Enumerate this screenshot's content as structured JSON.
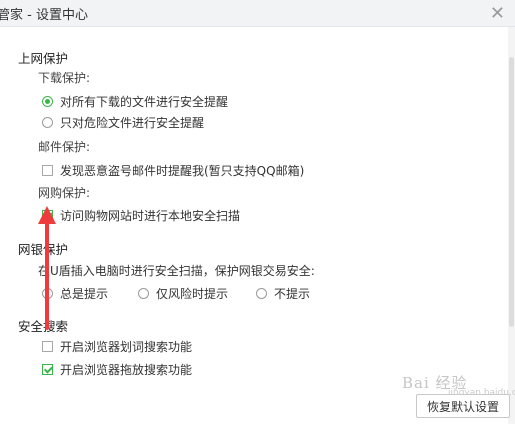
{
  "window": {
    "title": "管家 - 设置中心"
  },
  "sections": [
    {
      "title": "上网保护",
      "groups": [
        {
          "label": "下载保护:",
          "options": [
            {
              "type": "radio",
              "label": "对所有下载的文件进行安全提醒",
              "checked": true
            },
            {
              "type": "radio",
              "label": "只对危险文件进行安全提醒",
              "checked": false
            }
          ]
        },
        {
          "label": "邮件保护:",
          "options": [
            {
              "type": "checkbox",
              "label": "发现恶意盗号邮件时提醒我(暂只支持QQ邮箱)",
              "checked": false
            }
          ]
        },
        {
          "label": "网购保护:",
          "options": [
            {
              "type": "checkbox",
              "label": "访问购物网站时进行本地安全扫描",
              "checked": true
            }
          ]
        }
      ]
    },
    {
      "title": "网银保护",
      "description": "在U盾插入电脑时进行安全扫描，保护网银交易安全:",
      "options": [
        {
          "type": "radio",
          "label": "总是提示",
          "checked": false
        },
        {
          "type": "radio",
          "label": "仅风险时提示",
          "checked": false
        },
        {
          "type": "radio",
          "label": "不提示",
          "checked": false
        }
      ]
    },
    {
      "title": "安全搜索",
      "options": [
        {
          "type": "checkbox",
          "label": "开启浏览器划词搜索功能",
          "checked": false
        },
        {
          "type": "checkbox",
          "label": "开启浏览器拖放搜索功能",
          "checked": true
        }
      ]
    }
  ],
  "footer": {
    "restore_label": "恢复默认设置"
  },
  "annotation": {
    "arrow_color": "#ee3b3b"
  },
  "watermark": {
    "text": "Bai 经验",
    "sub": "jingyan.baidu.com"
  }
}
